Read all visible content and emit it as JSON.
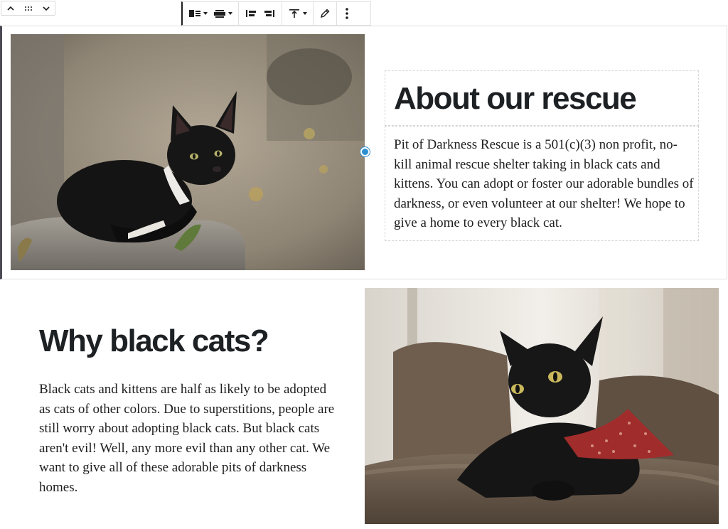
{
  "mover": {
    "icons": [
      "chevron-up-icon",
      "drag-handle-icon",
      "chevron-down-icon"
    ]
  },
  "toolbar": {
    "groups": [
      [
        "media-on-left-icon",
        "align-center-icon"
      ],
      [
        "show-media-left-icon",
        "show-media-right-icon"
      ],
      [
        "vertical-align-top-icon"
      ],
      [
        "edit-pencil-icon"
      ],
      [
        "more-options-icon"
      ]
    ]
  },
  "block1": {
    "heading": "About our rescue",
    "paragraph": "Pit of Darkness Rescue is a 501(c)(3) non profit, no-kill animal rescue shelter taking in black cats and kittens. You can adopt or foster our adorable bundles of darkness, or even volunteer at our shelter! We hope to give a home to every black cat."
  },
  "block2": {
    "heading": "Why black cats?",
    "paragraph": "Black cats and kittens are half as likely to be adopted as cats of other colors. Due to superstitions, people are still worry about adopting black cats. But black cats aren't evil! Well, any more evil than any other cat. We want to give all of these adorable pits of darkness homes."
  },
  "colors": {
    "accent": "#2d8fd0",
    "text": "#1e1e1e",
    "border": "#e0e0e0"
  }
}
